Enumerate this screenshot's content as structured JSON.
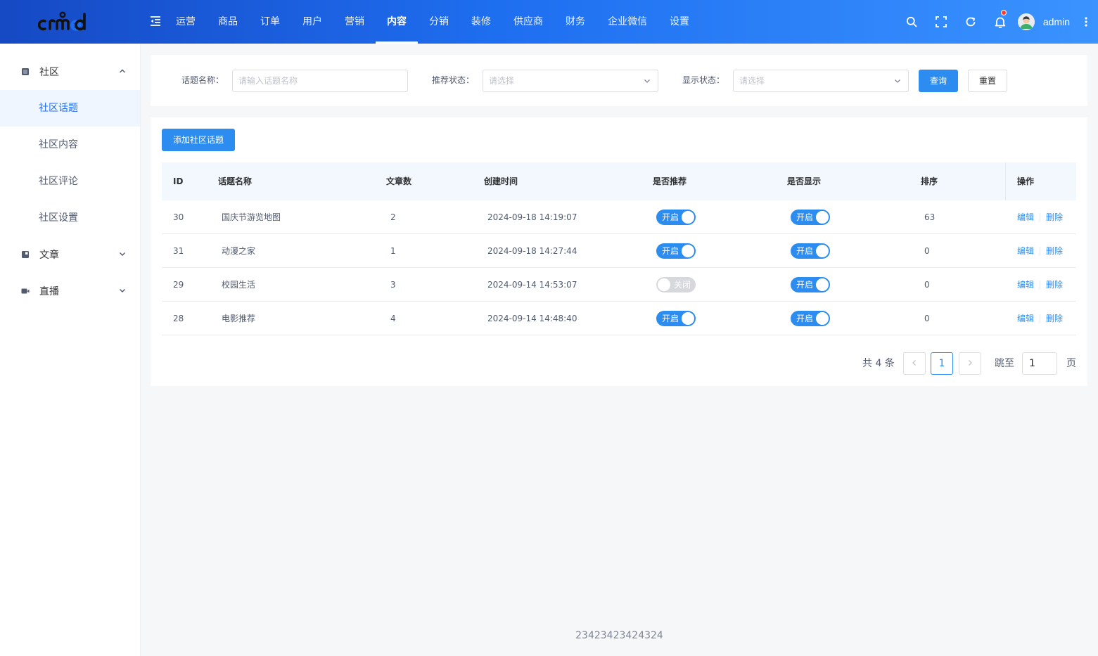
{
  "header": {
    "nav": [
      "运营",
      "商品",
      "订单",
      "用户",
      "营销",
      "内容",
      "分销",
      "装修",
      "供应商",
      "财务",
      "企业微信",
      "设置"
    ],
    "active_nav": "内容",
    "username": "admin",
    "icons": [
      "menu-collapse-icon",
      "search-icon",
      "fullscreen-icon",
      "refresh-icon",
      "bell-icon",
      "more-vertical-icon"
    ],
    "accent": "#1e6ef0"
  },
  "sidebar": {
    "groups": [
      {
        "label": "社区",
        "icon": "community-icon",
        "expanded": true,
        "items": [
          "社区话题",
          "社区内容",
          "社区评论",
          "社区设置"
        ],
        "active_item": "社区话题"
      },
      {
        "label": "文章",
        "icon": "article-icon",
        "expanded": false
      },
      {
        "label": "直播",
        "icon": "live-icon",
        "expanded": false
      }
    ]
  },
  "filter": {
    "name_label": "话题名称：",
    "name_placeholder": "请输入话题名称",
    "recommend_label": "推荐状态：",
    "recommend_placeholder": "请选择",
    "display_label": "显示状态：",
    "display_placeholder": "请选择",
    "query_button": "查询",
    "reset_button": "重置"
  },
  "toolbar": {
    "add_button": "添加社区话题"
  },
  "table": {
    "columns": [
      "ID",
      "话题名称",
      "文章数",
      "创建时间",
      "是否推荐",
      "是否显示",
      "排序",
      "操作"
    ],
    "switch_on_text": "开启",
    "switch_off_text": "关闭",
    "edit_label": "编辑",
    "delete_label": "删除",
    "rows": [
      {
        "id": "30",
        "name": "国庆节游览地图",
        "count": "2",
        "created": "2024-09-18 14:19:07",
        "recommend": true,
        "display": true,
        "sort": "63"
      },
      {
        "id": "31",
        "name": "动漫之家",
        "count": "1",
        "created": "2024-09-18 14:27:44",
        "recommend": true,
        "display": true,
        "sort": "0"
      },
      {
        "id": "29",
        "name": "校园生活",
        "count": "3",
        "created": "2024-09-14 14:53:07",
        "recommend": false,
        "display": true,
        "sort": "0"
      },
      {
        "id": "28",
        "name": "电影推荐",
        "count": "4",
        "created": "2024-09-14 14:48:40",
        "recommend": true,
        "display": true,
        "sort": "0"
      }
    ]
  },
  "pagination": {
    "total_text": "共 4 条",
    "current_page": "1",
    "jump_label": "跳至",
    "jump_value": "1",
    "page_suffix": "页"
  },
  "footer": {
    "text": "23423423424324"
  }
}
